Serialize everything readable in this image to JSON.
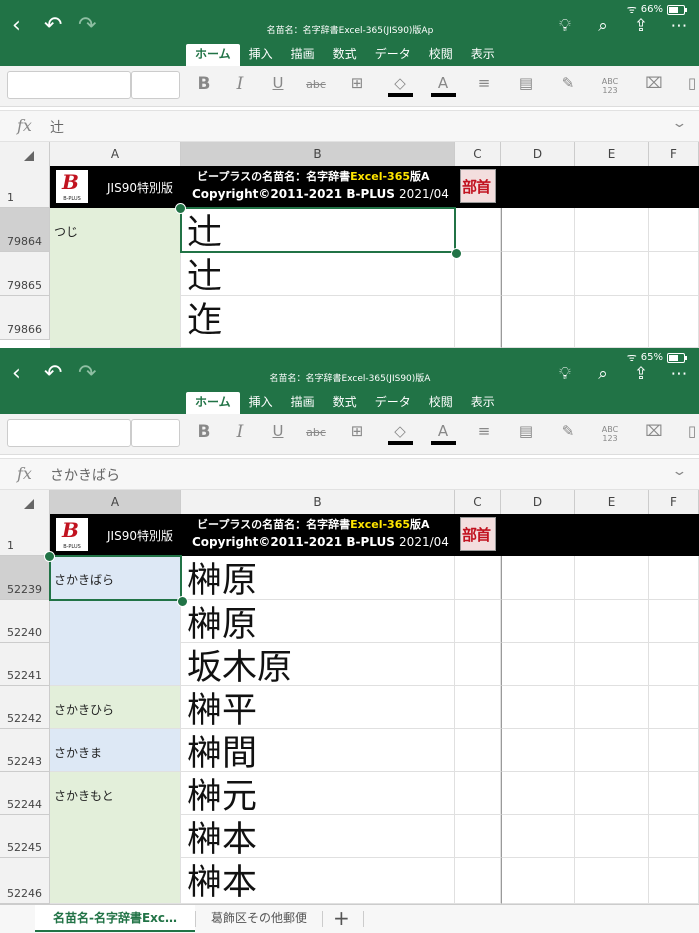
{
  "top_panel": {
    "status": {
      "battery": "66%",
      "battery_level": 0.66
    },
    "title": "名苗名：名字辞書Excel-365(JIS90)版Ap",
    "formula_value": "辻",
    "rows": [
      {
        "num": "79864",
        "a": "つじ",
        "b": "辻"
      },
      {
        "num": "79865",
        "a": "",
        "b": "辻"
      },
      {
        "num": "79866",
        "a": "",
        "b": "迮"
      }
    ]
  },
  "bottom_panel": {
    "status": {
      "battery": "65%",
      "battery_level": 0.65
    },
    "title": "名苗名：名字辞書Excel-365(JIS90)版A",
    "formula_value": "さかきばら",
    "rows": [
      {
        "num": "52239",
        "a": "さかきばら",
        "b": "榊原"
      },
      {
        "num": "52240",
        "a": "",
        "b": "榊原"
      },
      {
        "num": "52241",
        "a": "",
        "b": "坂木原"
      },
      {
        "num": "52242",
        "a": "さかきひら",
        "b": "榊平"
      },
      {
        "num": "52243",
        "a": "さかきま",
        "b": "榊間"
      },
      {
        "num": "52244",
        "a": "さかきもと",
        "b": "榊元"
      },
      {
        "num": "52245",
        "a": "",
        "b": "榊本"
      },
      {
        "num": "52246",
        "a": "",
        "b": "榊本"
      }
    ]
  },
  "tabs": [
    "ホーム",
    "挿入",
    "描画",
    "数式",
    "データ",
    "校閲",
    "表示"
  ],
  "ribbon": {
    "bold": "B",
    "italic": "I",
    "underline": "U",
    "strike": "abc",
    "spell": "ABC\n123"
  },
  "fx_label": "fx",
  "columns": [
    "A",
    "B",
    "C",
    "D",
    "E",
    "F"
  ],
  "banner": {
    "logo_letter": "B",
    "logo_text": "B-PLUS",
    "jis_label": "JIS90特別版",
    "line1_prefix": "ビープラスの名苗名：名字辞書",
    "line1_highlight": "Excel-365",
    "line1_suffix": "版A",
    "line2_main": "Copyright©2011-2021 B-PLUS",
    "line2_date": "2021/04",
    "bushu_label": "部首"
  },
  "header_row_num": "1",
  "sheets": {
    "active": "名苗名-名字辞書Exc…",
    "other": "葛飾区その他郵便",
    "add": "+"
  },
  "colors": {
    "excel_green": "#217346",
    "cell_green": "#e3efda",
    "cell_blue": "#dde8f5",
    "highlight_yellow": "#ffe500"
  }
}
